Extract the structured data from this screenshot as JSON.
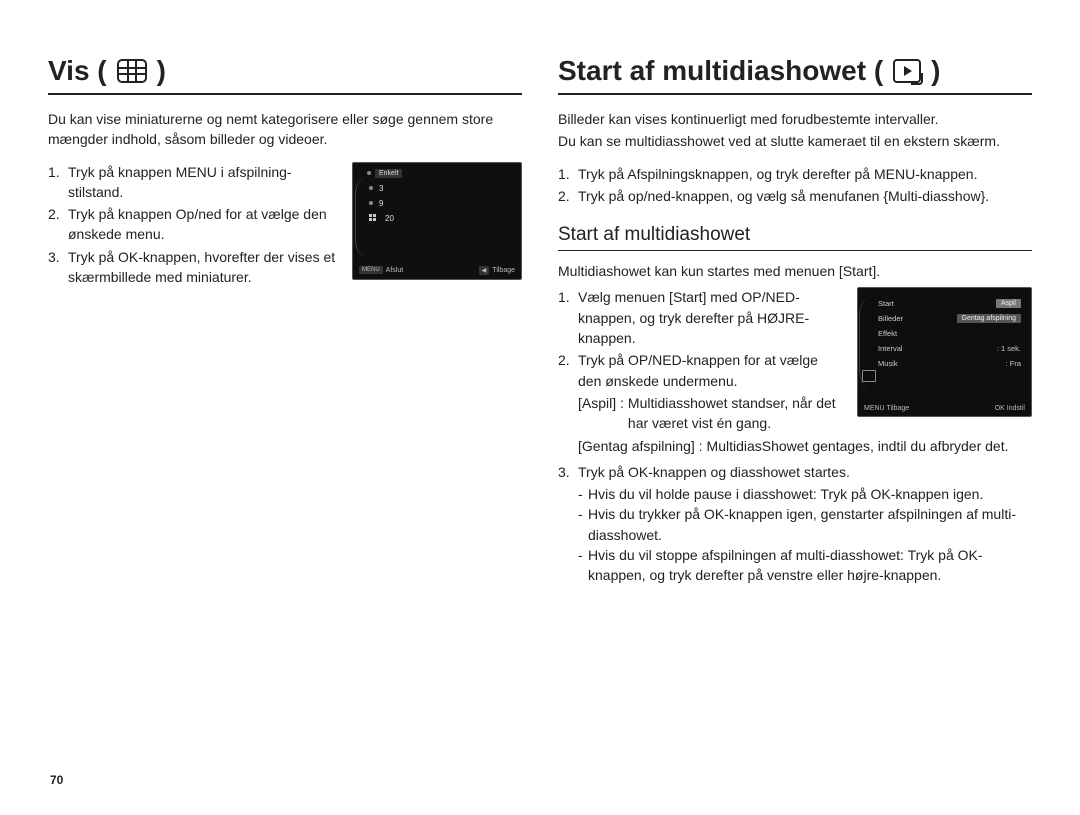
{
  "page_number": "70",
  "left": {
    "heading": "Vis  (",
    "heading_close": ")",
    "intro": "Du kan vise miniaturerne og nemt kategorisere eller søge gennem store mængder indhold, såsom billeder og videoer.",
    "steps": [
      {
        "n": "1.",
        "t": "Tryk på knappen MENU i afspilning-stilstand."
      },
      {
        "n": "2.",
        "t": "Tryk på knappen Op/ned for at vælge den ønskede menu."
      },
      {
        "n": "3.",
        "t": "Tryk på OK-knappen, hvorefter der vises et skærmbillede med miniaturer."
      }
    ],
    "lcd": {
      "item_label": "Enkelt",
      "num3": "3",
      "num9": "9",
      "num20": "20",
      "footer_left_key": "MENU",
      "footer_left": "Afslut",
      "footer_right_key": "◀",
      "footer_right": "Tilbage"
    }
  },
  "right": {
    "heading": "Start af multidiashowet  (",
    "heading_close": ")",
    "intro1": "Billeder kan vises kontinuerligt med forudbestemte intervaller.",
    "intro2": "Du kan se multidiasshowet ved at slutte kameraet til en ekstern skærm.",
    "top_steps": [
      {
        "n": "1.",
        "t": "Tryk på Afspilningsknappen, og tryk derefter på MENU-knappen."
      },
      {
        "n": "2.",
        "t": "Tryk på op/ned-knappen, og vælg så menufanen {Multi-diasshow}."
      }
    ],
    "subheading": "Start af multidiashowet",
    "sub_intro": "Multidiashowet kan kun startes med menuen [Start].",
    "sub_steps": [
      {
        "n": "1.",
        "t": "Vælg menuen [Start] med OP/NED-knappen, og tryk derefter på HØJRE-knappen."
      },
      {
        "n": "2.",
        "t": "Tryk på OP/NED-knappen for at vælge den ønskede undermenu."
      }
    ],
    "defs": [
      {
        "k": "[Aspil]  : ",
        "v": "Multidiasshowet standser, når det har været vist én gang."
      },
      {
        "k": "[Gentag afspilning]  : ",
        "v": "MultidiasShowet gentages, indtil du afbryder det."
      }
    ],
    "step3_n": "3.",
    "step3_t": "Tryk på OK-knappen og diasshowet startes.",
    "bullets": [
      "Hvis du vil holde pause i diasshowet: Tryk på OK-knappen igen.",
      "Hvis du trykker på OK-knappen igen, genstarter afspilningen af multi-diasshowet.",
      "Hvis du vil stoppe afspilningen af multi-diasshowet: Tryk på OK-knappen, og tryk derefter på venstre eller højre-knappen."
    ],
    "lcd2": {
      "items": [
        {
          "label": "Start",
          "val": "Aspil",
          "hi": true
        },
        {
          "label": "Billeder",
          "val": "Gentag afspilning",
          "hi": false
        },
        {
          "label": "Effekt",
          "val": "",
          "hi": false
        },
        {
          "label": "Interval",
          "val": ": 1 sek.",
          "hi": false,
          "plain": true
        },
        {
          "label": "Musik",
          "val": ": Fra",
          "hi": false,
          "plain": true
        }
      ],
      "footer_left_key": "MENU",
      "footer_left": "Tilbage",
      "footer_right_key": "OK",
      "footer_right": "Indstil"
    }
  }
}
